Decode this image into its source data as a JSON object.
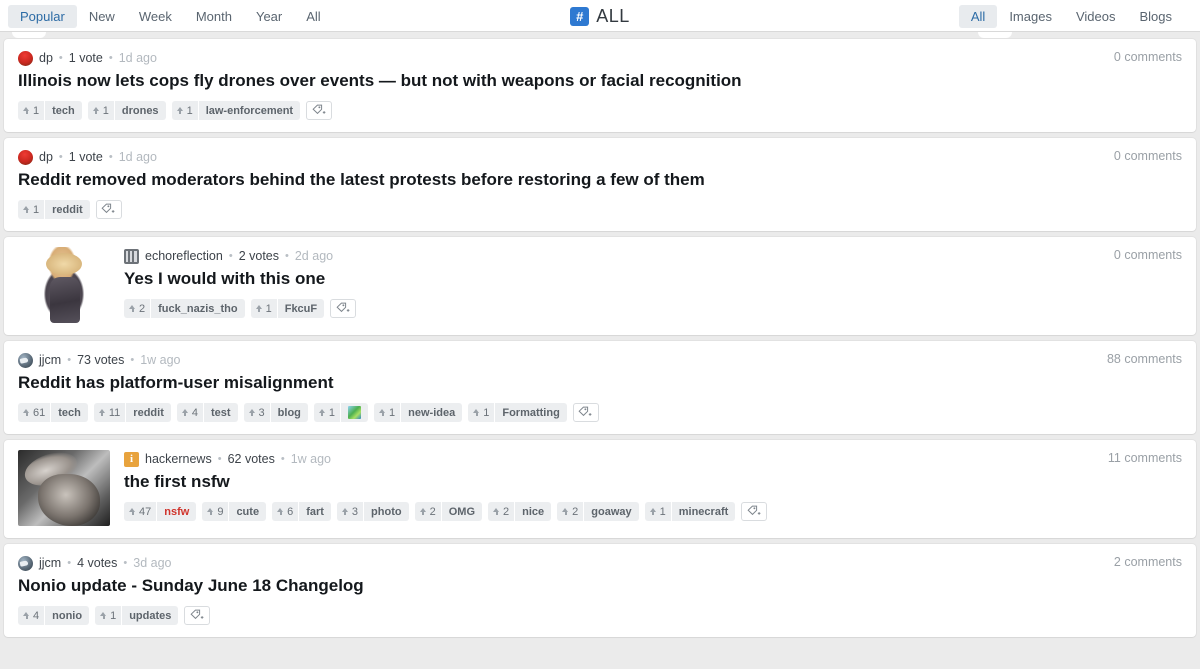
{
  "header": {
    "brand": {
      "badge": "#",
      "text": "ALL",
      "badge_color": "#2e79d1"
    },
    "left_nav": [
      {
        "label": "Popular",
        "active": true
      },
      {
        "label": "New",
        "active": false
      },
      {
        "label": "Week",
        "active": false
      },
      {
        "label": "Month",
        "active": false
      },
      {
        "label": "Year",
        "active": false
      },
      {
        "label": "All",
        "active": false
      }
    ],
    "right_nav": [
      {
        "label": "All",
        "active": true
      },
      {
        "label": "Images",
        "active": false
      },
      {
        "label": "Videos",
        "active": false
      },
      {
        "label": "Blogs",
        "active": false
      }
    ]
  },
  "posts": [
    {
      "author": "dp",
      "avatar": "avatar-red-circle",
      "votes": "1 vote",
      "age": "1d ago",
      "title": "Illinois now lets cops fly drones over events — but not with weapons or facial recognition",
      "comments": "0 comments",
      "thumb": null,
      "tags": [
        {
          "count": "1",
          "name": "tech"
        },
        {
          "count": "1",
          "name": "drones"
        },
        {
          "count": "1",
          "name": "law-enforcement"
        }
      ]
    },
    {
      "author": "dp",
      "avatar": "avatar-red-circle",
      "votes": "1 vote",
      "age": "1d ago",
      "title": "Reddit removed moderators behind the latest protests before restoring a few of them",
      "comments": "0 comments",
      "thumb": null,
      "tags": [
        {
          "count": "1",
          "name": "reddit"
        }
      ]
    },
    {
      "author": "echoreflection",
      "avatar": "avatar-dark-square",
      "votes": "2 votes",
      "age": "2d ago",
      "title": "Yes I would with this one",
      "comments": "0 comments",
      "thumb": "thumbnail-figure",
      "tags": [
        {
          "count": "2",
          "name": "fuck_nazis_tho"
        },
        {
          "count": "1",
          "name": "FkcuF"
        }
      ]
    },
    {
      "author": "jjcm",
      "avatar": "avatar-globe",
      "votes": "73 votes",
      "age": "1w ago",
      "title": "Reddit has platform-user misalignment",
      "comments": "88 comments",
      "thumb": null,
      "tags": [
        {
          "count": "61",
          "name": "tech"
        },
        {
          "count": "11",
          "name": "reddit"
        },
        {
          "count": "4",
          "name": "test"
        },
        {
          "count": "3",
          "name": "blog"
        },
        {
          "count": "1",
          "name": "",
          "emoji": true
        },
        {
          "count": "1",
          "name": "new-idea"
        },
        {
          "count": "1",
          "name": "Formatting"
        }
      ]
    },
    {
      "author": "hackernews",
      "avatar": "avatar-hackernews",
      "votes": "62 votes",
      "age": "1w ago",
      "title": "the first nsfw",
      "comments": "11 comments",
      "thumb": "thumbnail-photo",
      "tags": [
        {
          "count": "47",
          "name": "nsfw",
          "red": true
        },
        {
          "count": "9",
          "name": "cute"
        },
        {
          "count": "6",
          "name": "fart"
        },
        {
          "count": "3",
          "name": "photo"
        },
        {
          "count": "2",
          "name": "OMG"
        },
        {
          "count": "2",
          "name": "nice"
        },
        {
          "count": "2",
          "name": "goaway"
        },
        {
          "count": "1",
          "name": "minecraft"
        }
      ]
    },
    {
      "author": "jjcm",
      "avatar": "avatar-globe",
      "votes": "4 votes",
      "age": "3d ago",
      "title": "Nonio update - Sunday June 18 Changelog",
      "comments": "2 comments",
      "thumb": null,
      "tags": [
        {
          "count": "4",
          "name": "nonio"
        },
        {
          "count": "1",
          "name": "updates"
        }
      ]
    }
  ]
}
